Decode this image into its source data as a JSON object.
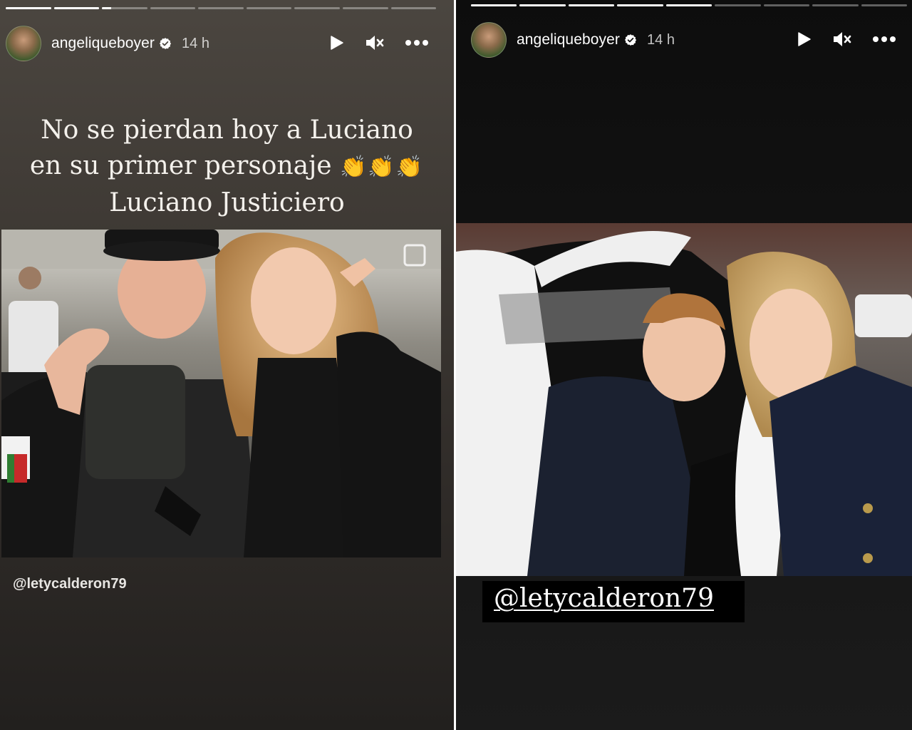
{
  "stories": [
    {
      "progress": [
        1,
        1,
        0.2,
        0,
        0,
        0,
        0,
        0,
        0
      ],
      "username": "angeliqueboyer",
      "time": "14 h",
      "caption": [
        "No se pierdan hoy a Luciano",
        "en su primer personaje",
        "Luciano Justiciero"
      ],
      "caption_emoji": "👏👏👏",
      "mention": "@letycalderon79"
    },
    {
      "progress": [
        1,
        1,
        1,
        1,
        1,
        0,
        0,
        0,
        0
      ],
      "username": "angeliqueboyer",
      "time": "14 h",
      "mention": "@letycalderon79"
    }
  ],
  "icons": {
    "play": "play-icon",
    "mute": "muted-speaker-icon",
    "more": "more-options-icon",
    "verified": "verified-badge-icon"
  },
  "colors": {
    "verified_badge": "#ffffff"
  }
}
